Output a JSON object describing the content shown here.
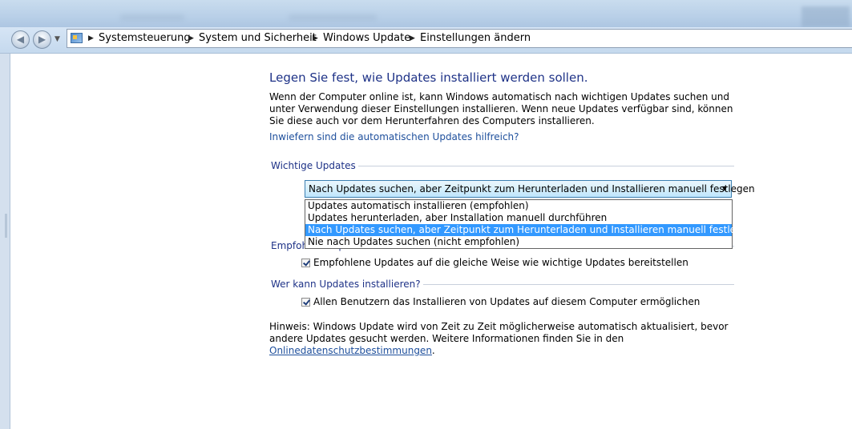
{
  "address": {
    "crumbs": [
      "Systemsteuerung",
      "System und Sicherheit",
      "Windows Update",
      "Einstellungen ändern"
    ]
  },
  "page": {
    "title": "Legen Sie fest, wie Updates installiert werden sollen.",
    "intro": "Wenn der Computer online ist, kann Windows automatisch nach wichtigen Updates suchen und unter Verwendung dieser Einstellungen installieren. Wenn neue Updates verfügbar sind, können Sie diese auch vor dem Herunterfahren des Computers installieren.",
    "help_link": "Inwiefern sind die automatischen Updates hilfreich?"
  },
  "important_updates": {
    "label": "Wichtige Updates",
    "selected": "Nach Updates suchen, aber Zeitpunkt zum Herunterladen und Installieren manuell festlegen",
    "options": [
      "Updates automatisch installieren (empfohlen)",
      "Updates herunterladen, aber Installation manuell durchführen",
      "Nach Updates suchen, aber Zeitpunkt zum Herunterladen und Installieren manuell festlegen",
      "Nie nach Updates suchen (nicht empfohlen)"
    ]
  },
  "recommended_updates": {
    "label": "Empfohlene Updates",
    "checkbox_label": "Empfohlene Updates auf die gleiche Weise wie wichtige Updates bereitstellen",
    "checked": true
  },
  "who_can_install": {
    "label": "Wer kann Updates installieren?",
    "checkbox_label": "Allen Benutzern das Installieren von Updates auf diesem Computer ermöglichen",
    "checked": true
  },
  "note": {
    "text_before": "Hinweis: Windows Update wird von Zeit zu Zeit möglicherweise automatisch aktualisiert, bevor andere Updates gesucht werden. Weitere Informationen finden Sie in den ",
    "link": "Onlinedatenschutzbestimmungen",
    "text_after": "."
  },
  "icons": {
    "back": "back-arrow-icon",
    "forward": "forward-arrow-icon",
    "control_panel": "control-panel-icon",
    "dropdown": "dropdown-arrow-icon",
    "checkbox": "checkmark-icon"
  },
  "colors": {
    "heading": "#1e3287",
    "link": "#1e4f9c",
    "selection": "#3399ff"
  }
}
